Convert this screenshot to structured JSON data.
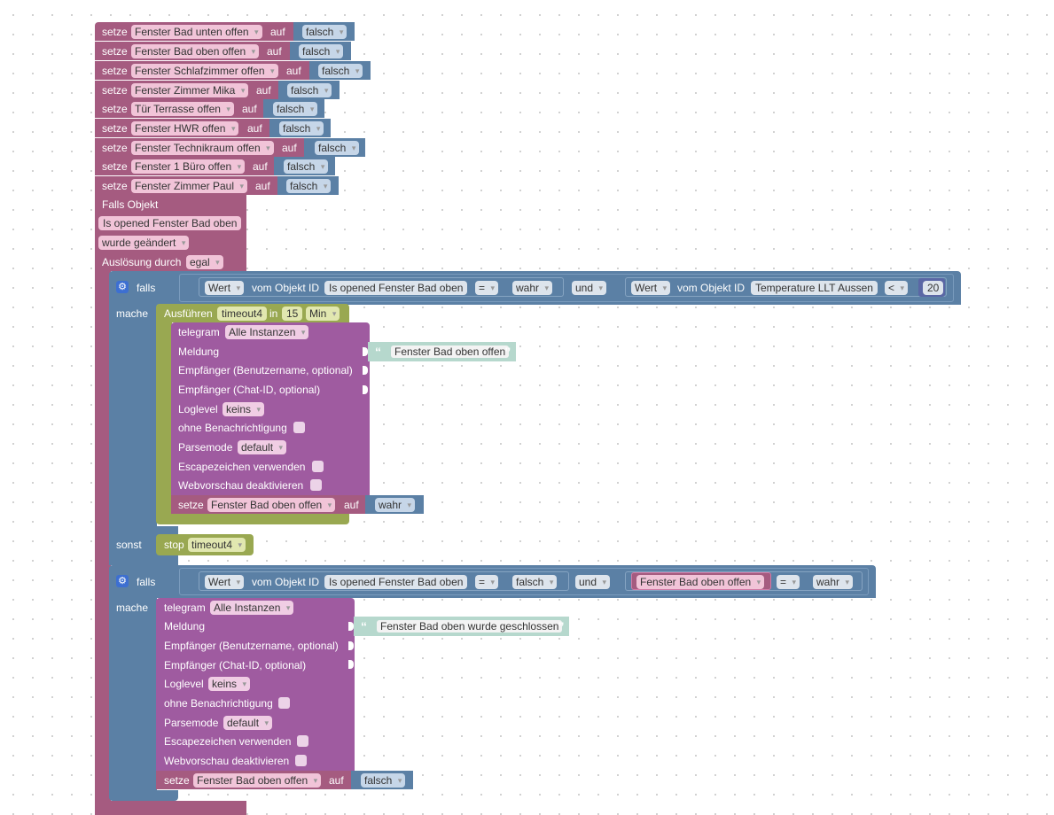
{
  "colors": {
    "variable": "#a55b80",
    "logic": "#5b80a5",
    "telegram": "#9f5ba0",
    "timeout": "#99a851",
    "string": "#b6d8cd",
    "bool_field": "#c6d6e8"
  },
  "setze_rows": [
    {
      "kw": "setze",
      "var": "Fenster Bad unten offen",
      "auf": "auf",
      "val": "falsch"
    },
    {
      "kw": "setze",
      "var": "Fenster Bad oben offen",
      "auf": "auf",
      "val": "falsch"
    },
    {
      "kw": "setze",
      "var": "Fenster Schlafzimmer offen",
      "auf": "auf",
      "val": "falsch"
    },
    {
      "kw": "setze",
      "var": "Fenster Zimmer Mika",
      "auf": "auf",
      "val": "falsch"
    },
    {
      "kw": "setze",
      "var": "Tür Terrasse offen",
      "auf": "auf",
      "val": "falsch"
    },
    {
      "kw": "setze",
      "var": "Fenster HWR offen",
      "auf": "auf",
      "val": "falsch"
    },
    {
      "kw": "setze",
      "var": "Fenster Technikraum offen",
      "auf": "auf",
      "val": "falsch"
    },
    {
      "kw": "setze",
      "var": "Fenster 1 Büro offen",
      "auf": "auf",
      "val": "falsch"
    },
    {
      "kw": "setze",
      "var": "Fenster Zimmer Paul",
      "auf": "auf",
      "val": "falsch"
    }
  ],
  "trigger": {
    "title": "Falls Objekt",
    "object": "Is opened Fenster Bad oben",
    "change": "wurde geändert",
    "ausloesung_label": "Auslösung durch",
    "ausloesung_val": "egal"
  },
  "if1": {
    "falls": "falls",
    "wert": "Wert",
    "vom": "vom Objekt ID",
    "obj1": "Is opened Fenster Bad oben",
    "op1": "=",
    "val1": "wahr",
    "und": "und",
    "wert2": "Wert",
    "vom2": "vom Objekt ID",
    "obj2": "Temperature LLT Aussen",
    "op2": "<",
    "num": "20",
    "mache": "mache",
    "sonst": "sonst"
  },
  "timeout_block": {
    "label": "Ausführen",
    "name": "timeout4",
    "in": "in",
    "amount": "15",
    "unit": "Min"
  },
  "tg1": {
    "telegram": "telegram",
    "instances": "Alle Instanzen",
    "meldung": "Meldung",
    "message": "Fenster Bad oben offen",
    "empf1": "Empfänger (Benutzername, optional)",
    "empf2": "Empfänger (Chat-ID, optional)",
    "loglevel": "Loglevel",
    "loglevel_val": "keins",
    "ohne": "ohne Benachrichtigung",
    "parsemode": "Parsemode",
    "parsemode_val": "default",
    "escape": "Escapezeichen verwenden",
    "webvorschau": "Webvorschau deaktivieren"
  },
  "setze_inner1": {
    "kw": "setze",
    "var": "Fenster Bad oben offen",
    "auf": "auf",
    "val": "wahr"
  },
  "stop_block": {
    "label": "stop",
    "name": "timeout4"
  },
  "if2": {
    "falls": "falls",
    "wert": "Wert",
    "vom": "vom Objekt ID",
    "obj1": "Is opened Fenster Bad oben",
    "op1": "=",
    "val1": "falsch",
    "und": "und",
    "var": "Fenster Bad oben offen",
    "op2": "=",
    "val2": "wahr",
    "mache": "mache"
  },
  "tg2": {
    "telegram": "telegram",
    "instances": "Alle Instanzen",
    "meldung": "Meldung",
    "message": "Fenster Bad oben wurde geschlossen",
    "empf1": "Empfänger (Benutzername, optional)",
    "empf2": "Empfänger (Chat-ID, optional)",
    "loglevel": "Loglevel",
    "loglevel_val": "keins",
    "ohne": "ohne Benachrichtigung",
    "parsemode": "Parsemode",
    "parsemode_val": "default",
    "escape": "Escapezeichen verwenden",
    "webvorschau": "Webvorschau deaktivieren"
  },
  "setze_inner2": {
    "kw": "setze",
    "var": "Fenster Bad oben offen",
    "auf": "auf",
    "val": "falsch"
  }
}
